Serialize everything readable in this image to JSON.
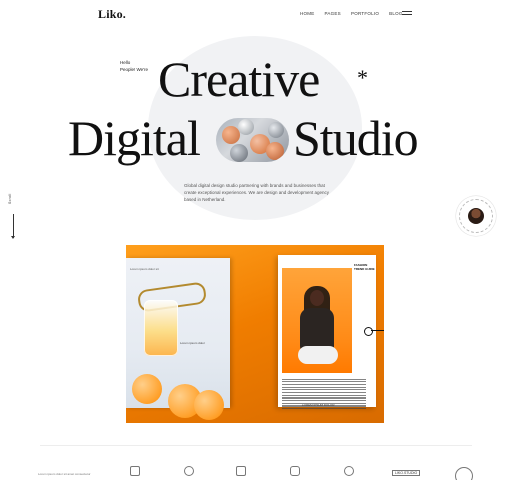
{
  "header": {
    "logo": "Liko.",
    "nav": [
      "HOME",
      "PAGES",
      "PORTFOLIO",
      "BLOG"
    ],
    "menu_icon": "hamburger-icon"
  },
  "hero": {
    "greeting": [
      "Hello",
      "People! We're"
    ],
    "line1": "Creative",
    "line2_left": "Digital",
    "line2_right": "Studio",
    "asterisk": "*",
    "description": "Global digital design studio partnering with brands and businesses that create exceptional experiences. We are design and development agency based in Netherland."
  },
  "side": {
    "scroll_label": "Scroll",
    "scroll_icon": "arrow-down-icon"
  },
  "badge": {
    "avatar_icon": "avatar-icon"
  },
  "magazine": {
    "left_page_title": "Lorem ipsum dolor sit",
    "left_mid_text": "Lorem ipsum dolor",
    "left_bottom_text": "Lorem ipsum dolor",
    "right_page_header": "FASHION TREND GUIDE",
    "right_footer": "LOREM IPSUM DOLOR"
  },
  "footer_strip": {
    "left_text": "Lorem ipsum dolor sit amet consectetur",
    "label": "LIKO.STUDIO"
  },
  "colors": {
    "accent_orange": "#ff8a16",
    "page_bg": "#ffffff",
    "hero_bg": "#f1f2f4"
  }
}
